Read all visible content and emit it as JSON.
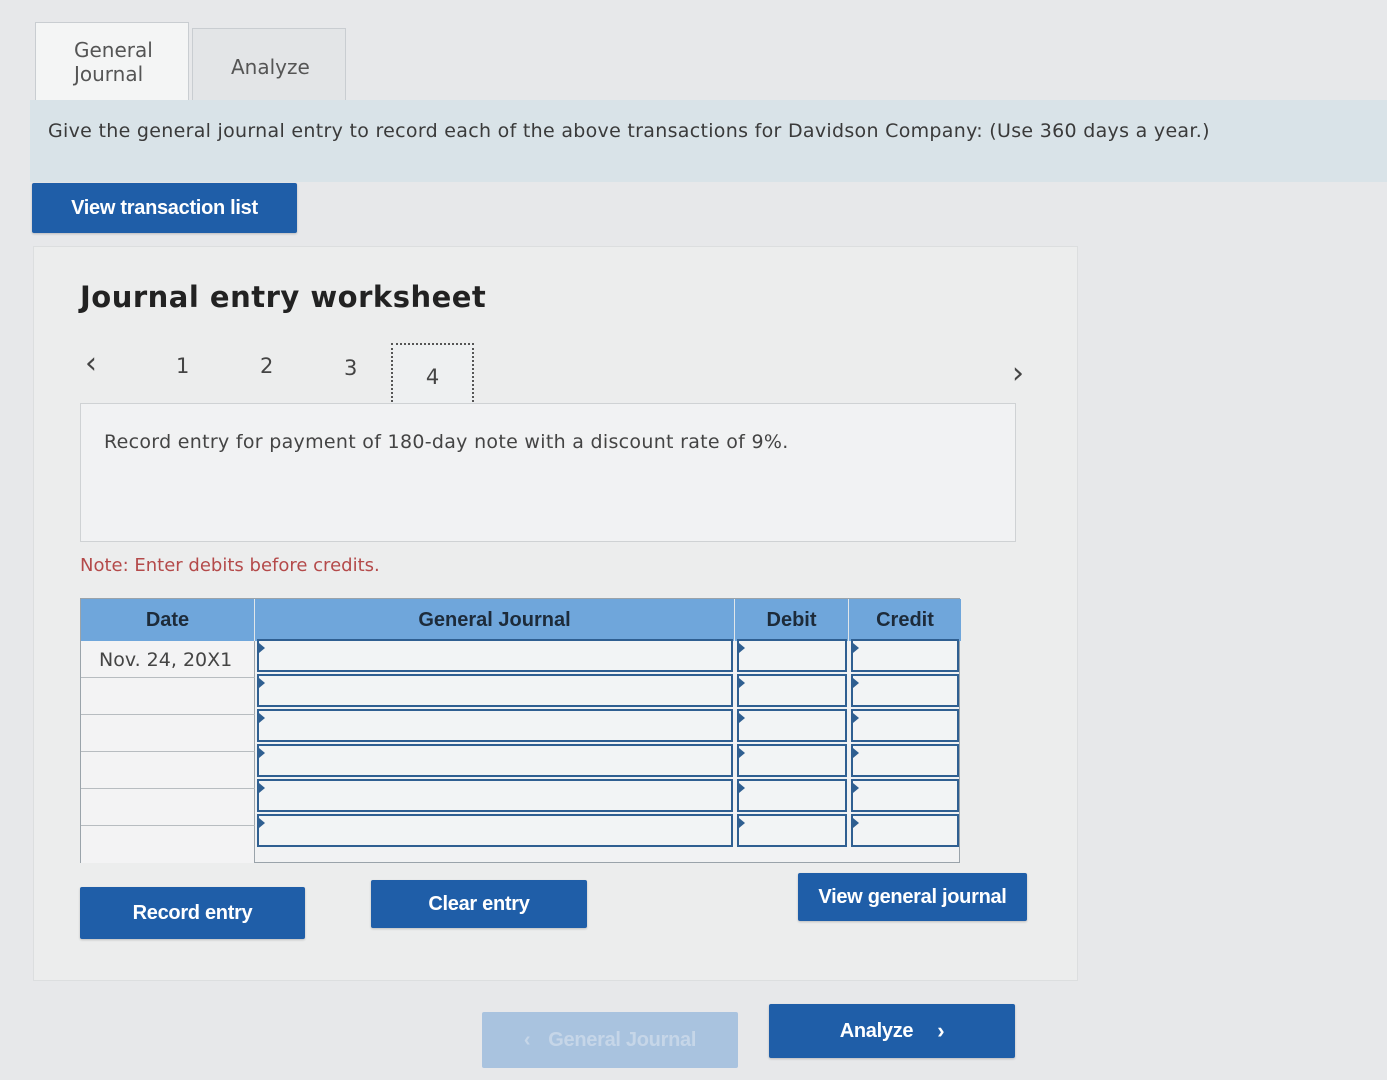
{
  "tabs": [
    {
      "line1": "General",
      "line2": "Journal"
    },
    {
      "label": "Analyze"
    }
  ],
  "instruction": "Give the general journal entry to record each of the above transactions for Davidson Company: (Use 360 days a year.)",
  "buttons": {
    "view_transactions": "View transaction list",
    "record_entry": "Record entry",
    "clear_entry": "Clear entry",
    "view_general_journal": "View general journal",
    "back": "General Journal",
    "next": "Analyze"
  },
  "worksheet": {
    "title": "Journal entry worksheet",
    "pages": [
      "1",
      "2",
      "3",
      "4"
    ],
    "entry_text": "Record entry for payment of 180-day note with a discount rate of 9%.",
    "note": "Note: Enter debits before credits."
  },
  "journal": {
    "headers": [
      "Date",
      "General Journal",
      "Debit",
      "Credit"
    ],
    "dates": [
      "Nov. 24, 20X1",
      "",
      "",
      "",
      "",
      ""
    ]
  },
  "icons": {
    "prev": "chevron-left-icon",
    "next": "chevron-right-icon"
  },
  "colors": {
    "button": "#1f5ea8",
    "header": "#6fa6db",
    "note": "#b44a4a"
  }
}
